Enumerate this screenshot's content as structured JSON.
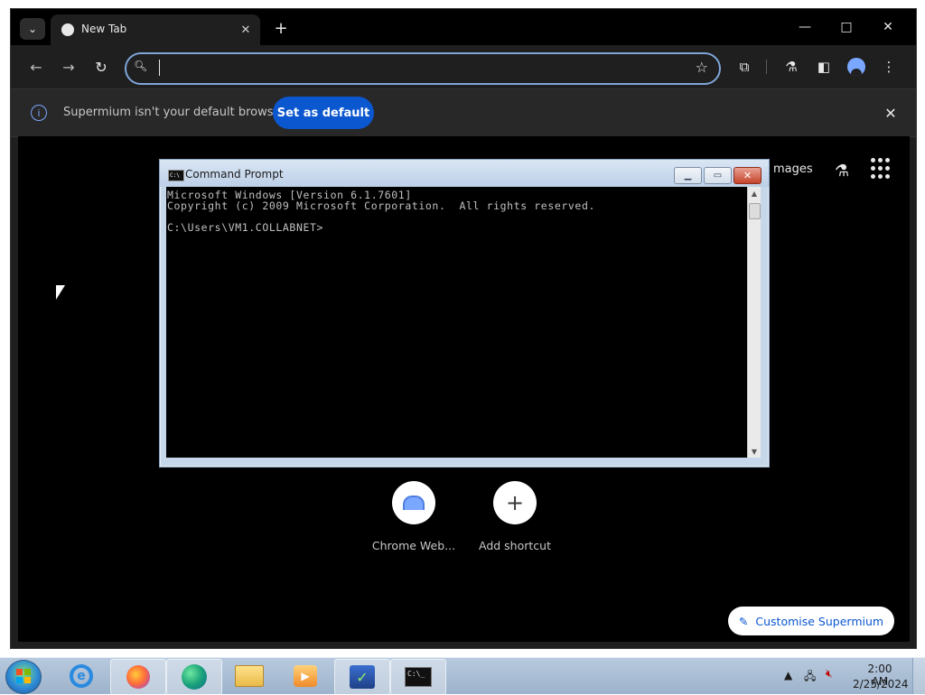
{
  "browser": {
    "tab": {
      "title": "New Tab"
    },
    "toolbar": {
      "address_value": ""
    },
    "infobar": {
      "message": "Supermium isn't your default browser",
      "button_label": "Set as default"
    },
    "content": {
      "images_link": "mages",
      "shortcuts": [
        {
          "label": "Chrome Web..."
        },
        {
          "label": "Add shortcut",
          "glyph": "+"
        }
      ],
      "customise_label": "Customise Supermium"
    }
  },
  "cmd": {
    "title": "Command Prompt",
    "lines": [
      "Microsoft Windows [Version 6.1.7601]",
      "Copyright (c) 2009 Microsoft Corporation.  All rights reserved.",
      "",
      "C:\\Users\\VM1.COLLABNET>"
    ]
  },
  "taskbar": {
    "apps": [
      "internet-explorer",
      "firefox",
      "edge",
      "file-explorer",
      "media-player",
      "task-app",
      "command-prompt"
    ],
    "clock": {
      "time": "2:00 AM",
      "date": "2/25/2024"
    }
  },
  "colors": {
    "accent": "#0b57d0",
    "browser_background": "#000000",
    "toolbar": "#1f1f1f"
  }
}
